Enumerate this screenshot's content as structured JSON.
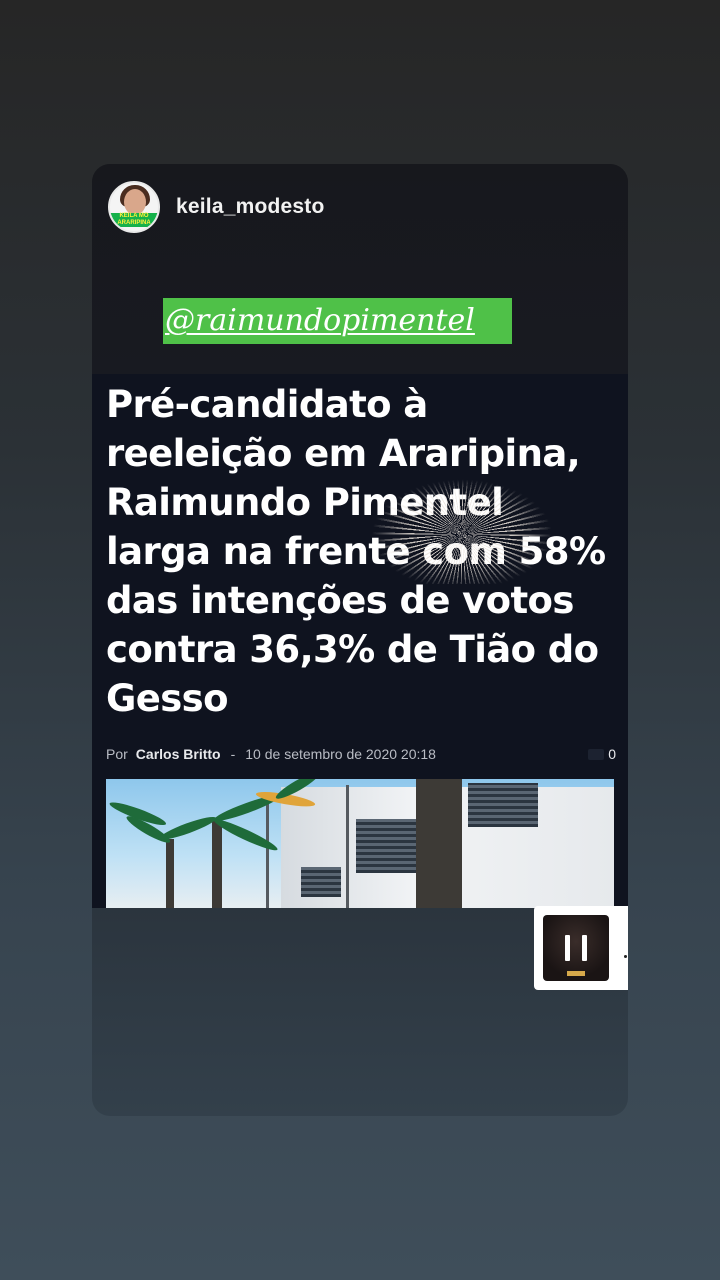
{
  "story": {
    "username": "keila_modesto",
    "avatar_banner_text": "KEILA MO ARARIPINA",
    "mention": "@raimundopimentel"
  },
  "article": {
    "headline": "Pré-candidato à reeleição em Araripina, Raimundo Pimentel larga na frente com 58% das intenções de votos contra 36,3% de Tião do Gesso",
    "by_label": "Por",
    "author": "Carlos Britto",
    "separator": "-",
    "date": "10 de setembro de 2020 20:18",
    "comment_count": "0"
  },
  "music_sticker": {
    "icon": "music-album-cover-icon"
  }
}
